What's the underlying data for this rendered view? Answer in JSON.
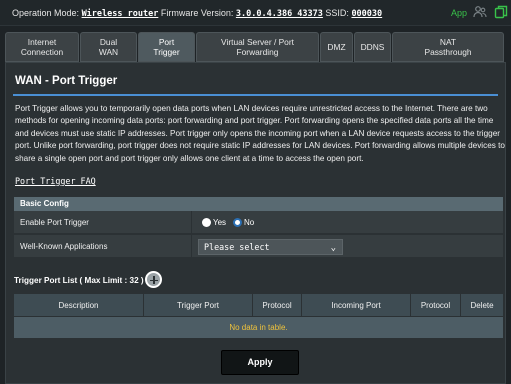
{
  "topbar": {
    "operation_mode_label": "Operation Mode:",
    "operation_mode_value": "Wireless router",
    "firmware_label": "Firmware Version:",
    "firmware_value": "3.0.0.4.386_43373",
    "ssid_label": "SSID:",
    "ssid_value": "000030",
    "app_label": "App",
    "app_color": "#39c24a"
  },
  "tabs": [
    {
      "label": "Internet\nConnection",
      "active": false
    },
    {
      "label": "Dual\nWAN",
      "active": false
    },
    {
      "label": "Port\nTrigger",
      "active": true
    },
    {
      "label": "Virtual Server / Port\nForwarding",
      "active": false
    },
    {
      "label": "DMZ",
      "active": false
    },
    {
      "label": "DDNS",
      "active": false
    },
    {
      "label": "NAT\nPassthrough",
      "active": false
    }
  ],
  "page": {
    "title": "WAN - Port Trigger",
    "description": "Port Trigger allows you to temporarily open data ports when LAN devices require unrestricted access to the Internet. There are two methods for opening incoming data ports: port forwarding and port trigger. Port forwarding opens the specified data ports all the time and devices must use static IP addresses. Port trigger only opens the incoming port when a LAN device requests access to the trigger port. Unlike port forwarding, port trigger does not require static IP addresses for LAN devices. Port forwarding allows multiple devices to share a single open port and port trigger only allows one client at a time to access the open port.",
    "faq_link": "Port Trigger FAQ"
  },
  "basic_config": {
    "header": "Basic Config",
    "enable_label": "Enable Port Trigger",
    "yes_label": "Yes",
    "no_label": "No",
    "enabled": false,
    "apps_label": "Well-Known Applications",
    "apps_selected": "Please select"
  },
  "trigger_list": {
    "title": "Trigger Port List ( Max Limit : 32 )",
    "columns": [
      "Description",
      "Trigger Port",
      "Protocol",
      "Incoming Port",
      "Protocol",
      "Delete"
    ],
    "empty_text": "No data in table."
  },
  "apply_label": "Apply",
  "colors": {
    "accent": "#4a8fd4",
    "empty_text": "#f0c33c"
  }
}
